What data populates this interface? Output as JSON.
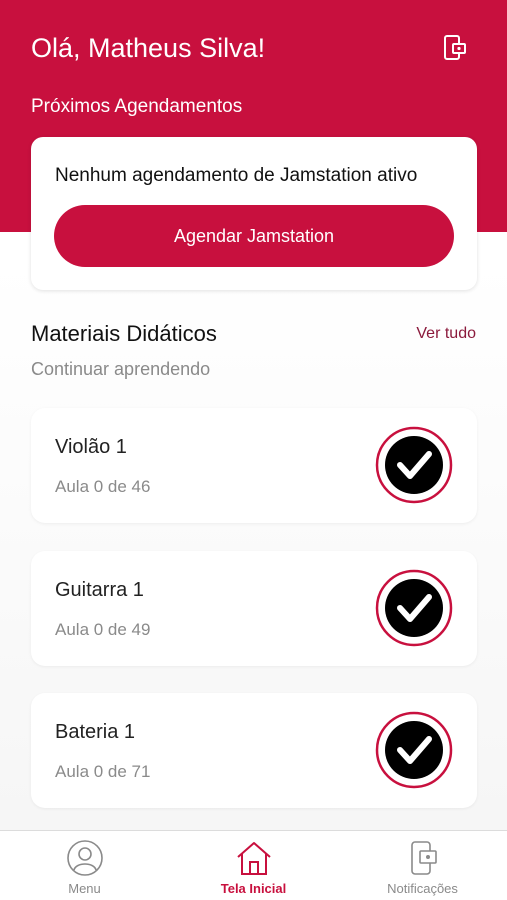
{
  "header": {
    "greeting": "Olá, Matheus Silva!",
    "section_title": "Próximos Agendamentos",
    "icon": "phone-notification-icon"
  },
  "schedule_card": {
    "message": "Nenhum agendamento de Jamstation ativo",
    "button_label": "Agendar Jamstation"
  },
  "materials": {
    "title": "Materiais Didáticos",
    "see_all": "Ver tudo",
    "subtitle": "Continuar aprendendo",
    "courses": [
      {
        "name": "Violão 1",
        "progress": "Aula 0 de 46",
        "icon": "checkmark-icon"
      },
      {
        "name": "Guitarra 1",
        "progress": "Aula 0 de 49",
        "icon": "checkmark-icon"
      },
      {
        "name": "Bateria 1",
        "progress": "Aula 0 de 71",
        "icon": "checkmark-icon"
      }
    ]
  },
  "tabbar": {
    "tabs": [
      {
        "label": "Menu",
        "icon": "user-icon",
        "active": false
      },
      {
        "label": "Tela Inicial",
        "icon": "home-icon",
        "active": true
      },
      {
        "label": "Notificações",
        "icon": "phone-notification-icon",
        "active": false
      }
    ]
  },
  "colors": {
    "brand": "#c8103e",
    "link": "#8b1a3c",
    "muted": "#8a8a8a"
  }
}
